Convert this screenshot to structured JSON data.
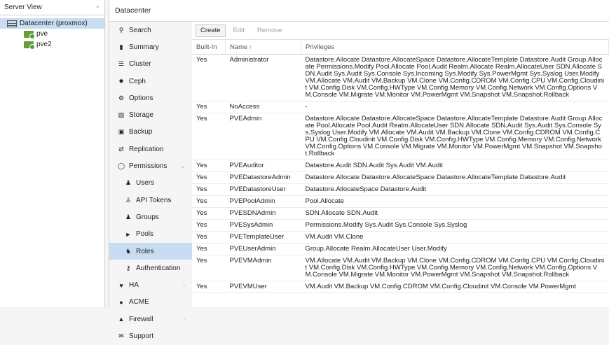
{
  "tree": {
    "view_label": "Server View",
    "datacenter": "Datacenter (proxmox)",
    "nodes": [
      "pve",
      "pve2"
    ]
  },
  "header": {
    "title": "Datacenter"
  },
  "menu": [
    {
      "label": "Search",
      "icon": "search-icon",
      "sub": false
    },
    {
      "label": "Summary",
      "icon": "book-icon",
      "sub": false
    },
    {
      "label": "Cluster",
      "icon": "server-icon",
      "sub": false
    },
    {
      "label": "Ceph",
      "icon": "ceph-icon",
      "sub": false
    },
    {
      "label": "Options",
      "icon": "gear-icon",
      "sub": false
    },
    {
      "label": "Storage",
      "icon": "database-icon",
      "sub": false
    },
    {
      "label": "Backup",
      "icon": "floppy-icon",
      "sub": false
    },
    {
      "label": "Replication",
      "icon": "retweet-icon",
      "sub": false
    },
    {
      "label": "Permissions",
      "icon": "unlock-icon",
      "sub": false,
      "expand": true
    },
    {
      "label": "Users",
      "icon": "user-icon",
      "sub": true
    },
    {
      "label": "API Tokens",
      "icon": "user-outline-icon",
      "sub": true
    },
    {
      "label": "Groups",
      "icon": "users-icon",
      "sub": true
    },
    {
      "label": "Pools",
      "icon": "tags-icon",
      "sub": true
    },
    {
      "label": "Roles",
      "icon": "male-icon",
      "sub": true,
      "active": true
    },
    {
      "label": "Authentication",
      "icon": "key-icon",
      "sub": true
    },
    {
      "label": "HA",
      "icon": "heartbeat-icon",
      "sub": false,
      "expand": true
    },
    {
      "label": "ACME",
      "icon": "certificate-icon",
      "sub": false
    },
    {
      "label": "Firewall",
      "icon": "shield-icon",
      "sub": false,
      "expand": true
    },
    {
      "label": "Support",
      "icon": "comments-icon",
      "sub": false
    }
  ],
  "toolbar": {
    "create": "Create",
    "edit": "Edit",
    "remove": "Remove"
  },
  "table": {
    "columns": {
      "builtin": "Built-In",
      "name": "Name",
      "privileges": "Privileges"
    },
    "rows": [
      {
        "builtin": "Yes",
        "name": "Administrator",
        "privileges": "Datastore.Allocate Datastore.AllocateSpace Datastore.AllocateTemplate Datastore.Audit Group.Allocate Permissions.Modify Pool.Allocate Pool.Audit Realm.Allocate Realm.AllocateUser SDN.Allocate SDN.Audit Sys.Audit Sys.Console Sys.Incoming Sys.Modify Sys.PowerMgmt Sys.Syslog User.Modify VM.Allocate VM.Audit VM.Backup VM.Clone VM.Config.CDROM VM.Config.CPU VM.Config.Cloudinit VM.Config.Disk VM.Config.HWType VM.Config.Memory VM.Config.Network VM.Config.Options VM.Console VM.Migrate VM.Monitor VM.PowerMgmt VM.Snapshot VM.Snapshot.Rollback"
      },
      {
        "builtin": "Yes",
        "name": "NoAccess",
        "privileges": "-"
      },
      {
        "builtin": "Yes",
        "name": "PVEAdmin",
        "privileges": "Datastore.Allocate Datastore.AllocateSpace Datastore.AllocateTemplate Datastore.Audit Group.Allocate Pool.Allocate Pool.Audit Realm.AllocateUser SDN.Allocate SDN.Audit Sys.Audit Sys.Console Sys.Syslog User.Modify VM.Allocate VM.Audit VM.Backup VM.Clone VM.Config.CDROM VM.Config.CPU VM.Config.Cloudinit VM.Config.Disk VM.Config.HWType VM.Config.Memory VM.Config.Network VM.Config.Options VM.Console VM.Migrate VM.Monitor VM.PowerMgmt VM.Snapshot VM.Snapshot.Rollback"
      },
      {
        "builtin": "Yes",
        "name": "PVEAuditor",
        "privileges": "Datastore.Audit SDN.Audit Sys.Audit VM.Audit"
      },
      {
        "builtin": "Yes",
        "name": "PVEDatastoreAdmin",
        "privileges": "Datastore.Allocate Datastore.AllocateSpace Datastore.AllocateTemplate Datastore.Audit"
      },
      {
        "builtin": "Yes",
        "name": "PVEDatastoreUser",
        "privileges": "Datastore.AllocateSpace Datastore.Audit"
      },
      {
        "builtin": "Yes",
        "name": "PVEPoolAdmin",
        "privileges": "Pool.Allocate"
      },
      {
        "builtin": "Yes",
        "name": "PVESDNAdmin",
        "privileges": "SDN.Allocate SDN.Audit"
      },
      {
        "builtin": "Yes",
        "name": "PVESysAdmin",
        "privileges": "Permissions.Modify Sys.Audit Sys.Console Sys.Syslog"
      },
      {
        "builtin": "Yes",
        "name": "PVETemplateUser",
        "privileges": "VM.Audit VM.Clone"
      },
      {
        "builtin": "Yes",
        "name": "PVEUserAdmin",
        "privileges": "Group.Allocate Realm.AllocateUser User.Modify"
      },
      {
        "builtin": "Yes",
        "name": "PVEVMAdmin",
        "privileges": "VM.Allocate VM.Audit VM.Backup VM.Clone VM.Config.CDROM VM.Config.CPU VM.Config.Cloudinit VM.Config.Disk VM.Config.HWType VM.Config.Memory VM.Config.Network VM.Config.Options VM.Console VM.Migrate VM.Monitor VM.PowerMgmt VM.Snapshot VM.Snapshot.Rollback"
      },
      {
        "builtin": "Yes",
        "name": "PVEVMUser",
        "privileges": "VM.Audit VM.Backup VM.Config.CDROM VM.Config.Cloudinit VM.Console VM.PowerMgmt"
      }
    ]
  }
}
